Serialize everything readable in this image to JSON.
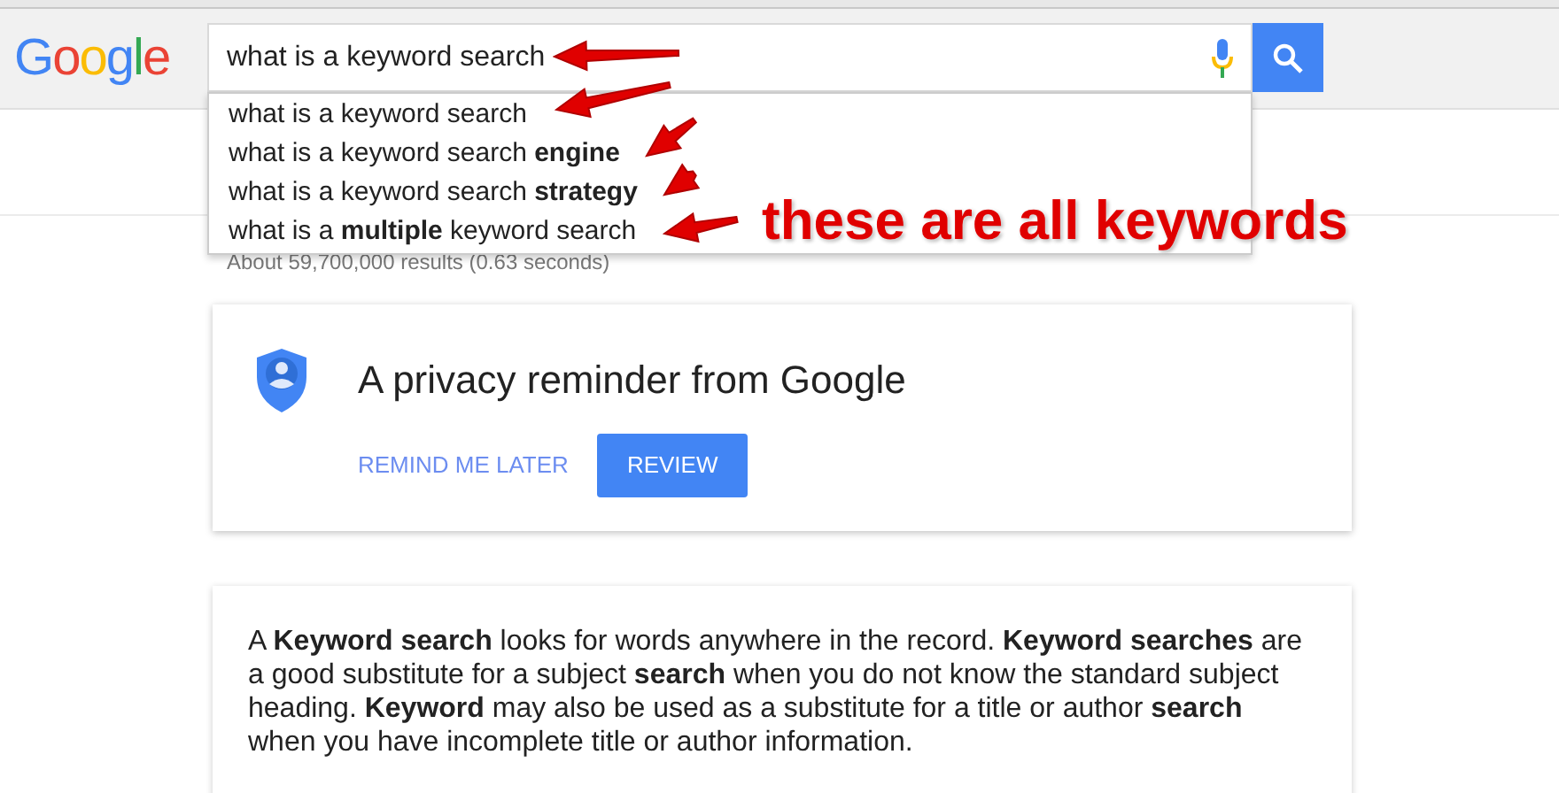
{
  "logo": "Google",
  "search": {
    "value": "what is a keyword search"
  },
  "suggestions": [
    "what is a keyword search",
    "what is a keyword search **engine**",
    "what is a keyword search **strategy**",
    "what is a **multiple** keyword search"
  ],
  "results_stats": "About 59,700,000 results (0.63 seconds)",
  "privacy_card": {
    "title": "A privacy reminder from Google",
    "buttons": [
      "REMIND ME LATER",
      "REVIEW"
    ]
  },
  "answer_card": {
    "text": "A **Keyword search** looks for words anywhere in the record. **Keyword searches** are a good substitute for a subject **search** when you do not know the standard subject heading. **Keyword** may also be used as a substitute for a title or author **search** when you have incomplete title or author information."
  },
  "annotation": "these are all keywords"
}
